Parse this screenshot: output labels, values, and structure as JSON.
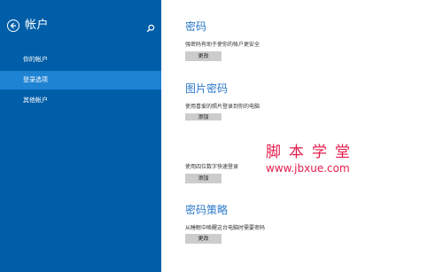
{
  "sidebar": {
    "title": "帐户",
    "nav_items": [
      {
        "label": "你的帐户",
        "active": false
      },
      {
        "label": "登录选项",
        "active": true
      },
      {
        "label": "其他帐户",
        "active": false
      }
    ]
  },
  "sections": {
    "password": {
      "title": "密码",
      "desc": "强密码有助于使你的帐户更安全",
      "button": "更改"
    },
    "picture_password": {
      "title": "图片密码",
      "desc": "使用喜爱的照片登录到你的电脑",
      "button": "添加"
    },
    "pin": {
      "desc": "使用四位数字快速登录",
      "button": "添加"
    },
    "password_policy": {
      "title": "密码策略",
      "desc": "从睡眠中唤醒这台电脑时需要密码",
      "button": "更改"
    }
  },
  "watermark": {
    "main": "脚本学堂",
    "url": "www.jbxue.com"
  },
  "colors": {
    "sidebar_bg": "#005ea8",
    "sidebar_active": "#1e83d3",
    "section_title": "#2a78c9",
    "button_bg": "#cccccc",
    "watermark": "#e31d4c"
  },
  "icons": {
    "back": "back-arrow-icon",
    "search": "search-icon"
  }
}
